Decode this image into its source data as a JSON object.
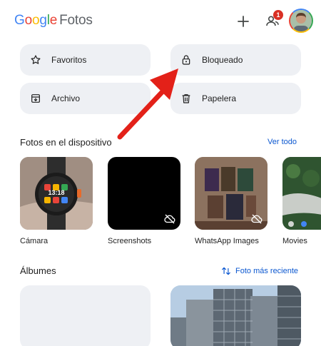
{
  "header": {
    "logo_google": [
      "G",
      "o",
      "o",
      "g",
      "l",
      "e"
    ],
    "logo_app": "Fotos",
    "notification_count": "1",
    "icons": [
      "plus-icon",
      "people-icon",
      "avatar"
    ]
  },
  "tiles": {
    "favorites": "Favoritos",
    "locked": "Bloqueado",
    "archive": "Archivo",
    "trash": "Papelera"
  },
  "device_section": {
    "title": "Fotos en el dispositivo",
    "see_all": "Ver todo",
    "folders": [
      "Cámara",
      "Screenshots",
      "WhatsApp Images",
      "Movies"
    ],
    "watch_time": "13:18"
  },
  "albums_section": {
    "title": "Álbumes",
    "sort": "Foto más reciente"
  },
  "colors": {
    "accent": "#0b57d0",
    "tile_bg": "#eef0f4",
    "arrow": "#e32119"
  }
}
